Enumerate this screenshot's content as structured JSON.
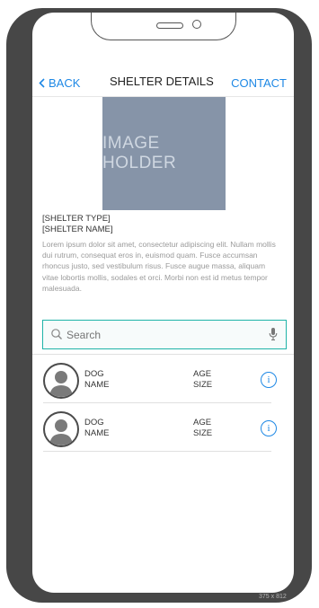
{
  "nav": {
    "back_label": "BACK",
    "title": "SHELTER DETAILS",
    "contact_label": "CONTACT"
  },
  "hero": {
    "text": "IMAGE HOLDER"
  },
  "shelter": {
    "type": "[SHELTER TYPE]",
    "name": "[SHELTER NAME]",
    "description": "Lorem ipsum dolor sit amet, consectetur adipiscing elit. Nullam mollis dui rutrum, consequat eros in, euismod quam. Fusce accumsan rhoncus justo, sed vestibulum risus. Fusce augue massa, aliquam vitae lobortis mollis, sodales et orci. Morbi non est id metus tempor malesuada."
  },
  "search": {
    "placeholder": "Search",
    "icon": "search-icon",
    "mic_icon": "microphone-icon"
  },
  "dogs": [
    {
      "line1": "DOG",
      "line2": "NAME",
      "line3": "AGE",
      "line4": "SIZE",
      "info_label": "i"
    },
    {
      "line1": "DOG",
      "line2": "NAME",
      "line3": "AGE",
      "line4": "SIZE",
      "info_label": "i"
    }
  ],
  "frame": {
    "size_label": "375 x 812"
  },
  "colors": {
    "accent": "#1e88e5",
    "search_border": "#1fb3a8",
    "image_placeholder": "#8694a8",
    "device": "#474747"
  }
}
